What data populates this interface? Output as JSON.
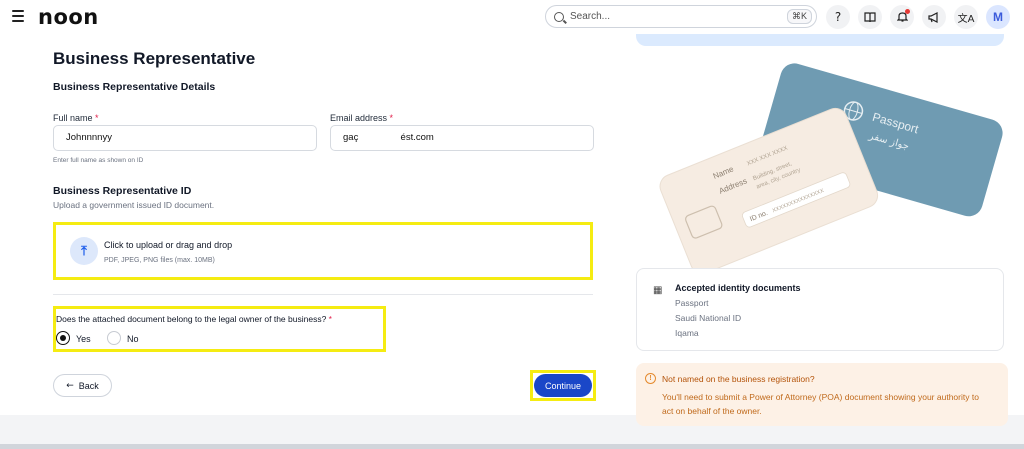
{
  "header": {
    "logo": "noon",
    "search_placeholder": "Search...",
    "search_shortcut": "⌘K",
    "avatar_initial": "M"
  },
  "form": {
    "title": "Business Representative",
    "subtitle": "Business Representative Details",
    "full_name_label": "Full name",
    "full_name_value": "Johnnnnyy",
    "full_name_hint": "Enter full name as shown on ID",
    "email_label": "Email address",
    "email_value": "gaç                ést.com",
    "required_mark": "*",
    "id_section_title": "Business Representative ID",
    "id_section_subtitle": "Upload a government issued ID document.",
    "upload_title": "Click to upload or drag and drop",
    "upload_subtitle": "PDF, JPEG, PNG files (max. 10MB)",
    "question": "Does the attached document belong to the legal owner of the business?",
    "option_yes": "Yes",
    "option_no": "No",
    "back_label": "Back",
    "continue_label": "Continue"
  },
  "illustration": {
    "passport_label": "Passport",
    "passport_arabic": "جواز سفر",
    "card_name": "Name",
    "card_name_value": "XXX XXX XXXX",
    "card_address": "Address",
    "card_address_value_1": "Building, street,",
    "card_address_value_2": "area, city, country",
    "card_id_label": "ID no.",
    "card_id_value": "XXXXXXXXXXXXXXX"
  },
  "accepted_docs": {
    "title": "Accepted identity documents",
    "items": [
      "Passport",
      "Saudi National ID",
      "Iqama"
    ]
  },
  "warning": {
    "title": "Not named on the business registration?",
    "body": "You'll need to submit a Power of Attorney (POA) document showing your authority to act on behalf of the owner."
  },
  "colors": {
    "primary": "#1a47c8",
    "highlight": "#f5ec12",
    "passport": "#6f9bb2",
    "warning_bg": "#fdf1e6"
  }
}
